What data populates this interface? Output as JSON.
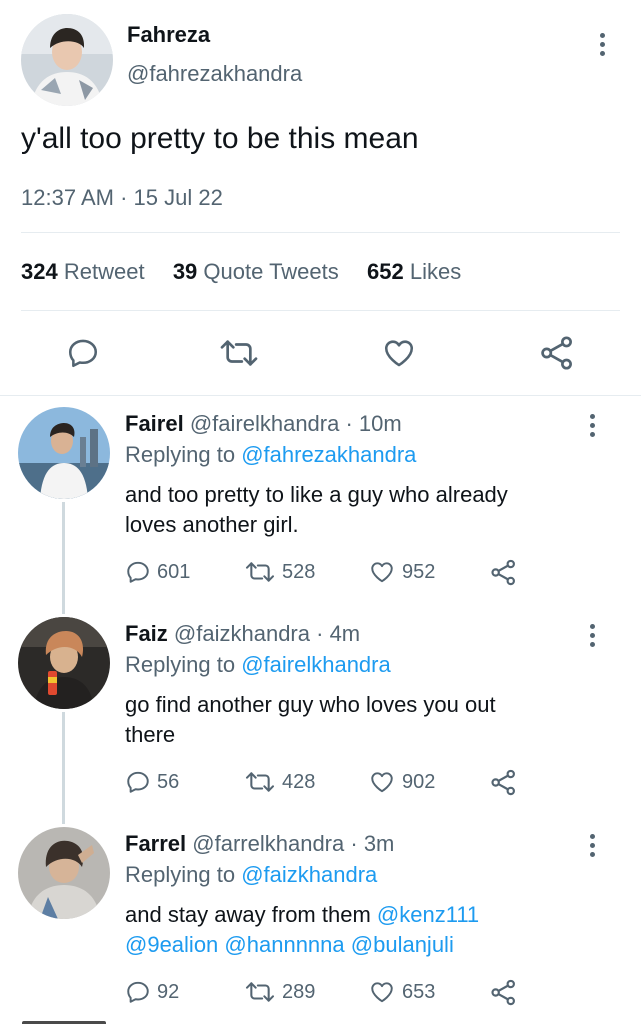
{
  "main_tweet": {
    "name": "Fahreza",
    "handle": "@fahrezakhandra",
    "text": "y'all too pretty to be this mean",
    "time": "12:37 AM",
    "separator": "·",
    "date": "15 Jul 22",
    "stats": {
      "retweets_count": "324",
      "retweets_label": "Retweet",
      "quotes_count": "39",
      "quotes_label": "Quote Tweets",
      "likes_count": "652",
      "likes_label": "Likes"
    }
  },
  "replies": [
    {
      "name": "Fairel",
      "handle": "@fairelkhandra",
      "age": "· 10m",
      "replying_prefix": "Replying to",
      "replying_handle": "@fahrezakhandra",
      "text_line1": "and too pretty to like a guy who already",
      "text_line2": "loves another girl.",
      "replies": "601",
      "retweets": "528",
      "likes": "952"
    },
    {
      "name": "Faiz",
      "handle": "@faizkhandra",
      "age": "· 4m",
      "replying_prefix": "Replying to",
      "replying_handle": "@fairelkhandra",
      "text_line1": "go find another guy who loves you out",
      "text_line2": "there",
      "replies": "56",
      "retweets": "428",
      "likes": "902"
    },
    {
      "name": "Farrel",
      "handle": "@farrelkhandra",
      "age": "· 3m",
      "replying_prefix": "Replying to",
      "replying_handle": "@faizkhandra",
      "text_line1": "and stay away from them",
      "mention1": "@kenz111",
      "mention2": "@9ealion",
      "mention3": "@hannnnna",
      "mention4": "@bulanjuli",
      "replies": "92",
      "retweets": "289",
      "likes": "653"
    }
  ],
  "colors": {
    "accent": "#1d9bf0",
    "muted": "#536471",
    "divider": "#e6ecf0",
    "thread_line": "#cfd9de"
  },
  "icons": [
    "more-icon",
    "reply-icon",
    "retweet-icon",
    "like-icon",
    "share-icon"
  ]
}
